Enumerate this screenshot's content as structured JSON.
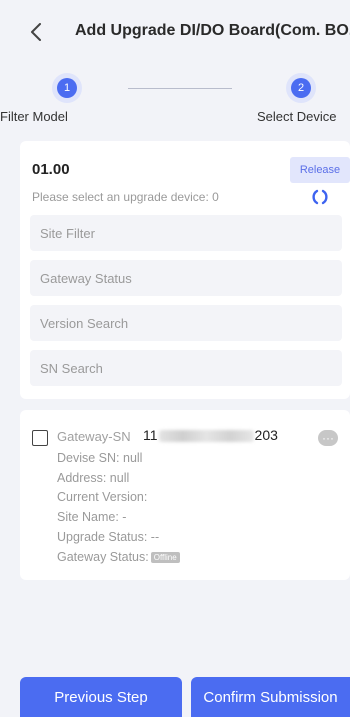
{
  "header": {
    "back_icon": "chevron-left-icon",
    "title": "Add Upgrade DI/DO Board(Com. BO..."
  },
  "steps": [
    {
      "number": "1",
      "label": "Filter Model"
    },
    {
      "number": "2",
      "label": "Select Device"
    }
  ],
  "main": {
    "version": "01.00",
    "release_label": "Release",
    "hint": "Please select an upgrade device: 0",
    "refresh_icon": "refresh-icon",
    "filters": {
      "site_placeholder": "Site Filter",
      "gateway_status_placeholder": "Gateway Status",
      "version_placeholder": "Version Search",
      "sn_placeholder": "SN Search"
    }
  },
  "devices": [
    {
      "gateway_sn_label": "Gateway-SN",
      "gateway_sn_prefix": "11",
      "gateway_sn_suffix": "203",
      "devise_sn": "Devise SN: null",
      "address": "Address: null",
      "current_version": "Current Version:",
      "site_name": "Site Name: -",
      "upgrade_status": "Upgrade Status: --",
      "gateway_status_label": "Gateway Status:",
      "gateway_status_badge": "Offline",
      "more_glyph": "···"
    }
  ],
  "footer": {
    "previous_label": "Previous Step",
    "confirm_label": "Confirm Submission"
  },
  "colors": {
    "accent": "#4b6cf1",
    "background": "#f2f3f8",
    "release_bg": "#e2e6fc"
  }
}
